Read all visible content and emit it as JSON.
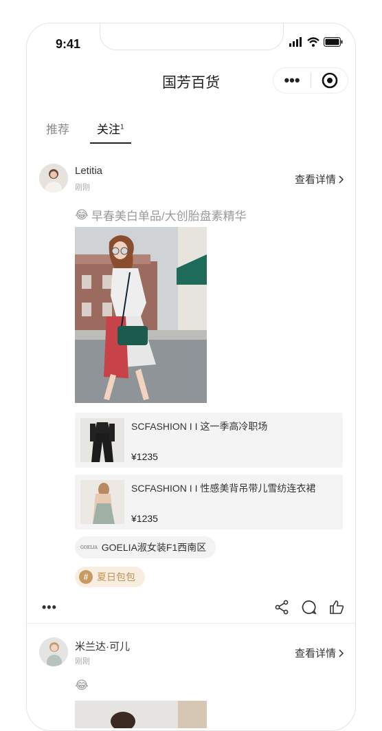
{
  "status_bar": {
    "time": "9:41"
  },
  "nav": {
    "title": "国芳百货",
    "more_label": "•••"
  },
  "tabs": [
    {
      "label": "推荐",
      "badge": ""
    },
    {
      "label": "关注",
      "badge": "1"
    }
  ],
  "posts": [
    {
      "username": "Letitia",
      "time": "刚刚",
      "detail_label": "查看详情",
      "caption_emoji": "😂",
      "caption": "早春美白单品/大创胎盘素精华",
      "products": [
        {
          "name": "SCFASHION I I 这一季高冷职场",
          "price": "¥1235"
        },
        {
          "name": "SCFASHION I I 性感美背吊带儿雪纺连衣裙",
          "price": "¥1235"
        }
      ],
      "shop": {
        "logo_text": "GOELIA",
        "name": "GOELIA淑女装F1西南区"
      },
      "topic": {
        "hash": "#",
        "label": "夏日包包"
      },
      "more_label": "•••"
    },
    {
      "username": "米兰达·可儿",
      "time": "刚刚",
      "detail_label": "查看详情",
      "caption_emoji": "😂"
    }
  ],
  "colors": {
    "accent_topic": "#c89a60",
    "topic_bg": "#f8eee0"
  }
}
